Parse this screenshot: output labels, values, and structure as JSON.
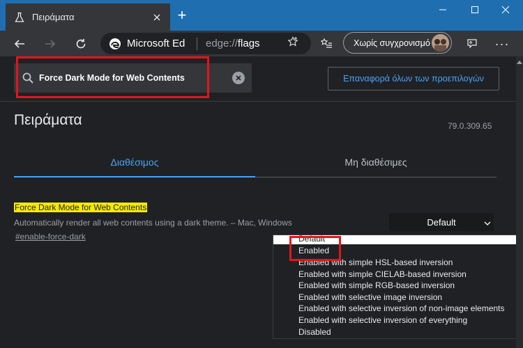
{
  "window": {
    "tab_title": "Πειράματα",
    "tab_icon": "flask-icon",
    "controls": [
      "minimize-icon",
      "maximize-icon",
      "close-icon"
    ]
  },
  "toolbar": {
    "site_name": "Microsoft Ed",
    "url_scheme": "edge://",
    "url_path": "flags",
    "sync_label": "Χωρίς συγχρονισμό"
  },
  "page": {
    "search_value": "Force Dark Mode for Web Contents",
    "reset_label": "Επαναφορά όλων των προεπιλογών",
    "title": "Πειράματα",
    "version": "79.0.309.65",
    "tabs": [
      {
        "label": "Διαθέσιμος",
        "active": true
      },
      {
        "label": "Μη διαθέσιμες",
        "active": false
      }
    ],
    "flag": {
      "name": "Force Dark Mode for Web Contents",
      "description": "Automatically render all web contents using a dark theme. – Mac, Windows",
      "link": "#enable-force-dark",
      "selected": "Default"
    },
    "dropdown_options": [
      "Default",
      "Enabled",
      "Enabled with simple HSL-based inversion",
      "Enabled with simple CIELAB-based inversion",
      "Enabled with simple RGB-based inversion",
      "Enabled with selective image inversion",
      "Enabled with selective inversion of non-image elements",
      "Enabled with selective inversion of everything",
      "Disabled"
    ]
  },
  "colors": {
    "accent": "#4aa3f5",
    "titlebar": "#1f6fb0",
    "highlight": "#f7ea00",
    "annotation": "#e4141b"
  }
}
